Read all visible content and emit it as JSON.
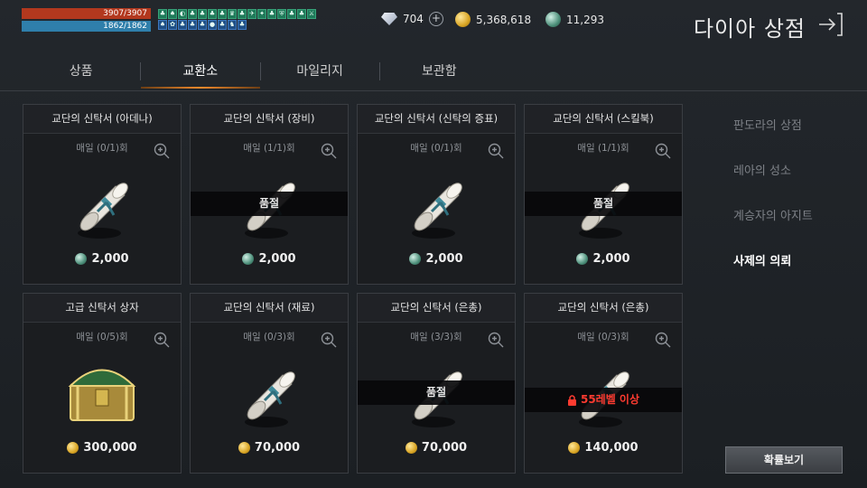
{
  "status": {
    "hp": "3907/3907",
    "mp": "1862/1862",
    "buff_row1": [
      "♣",
      "♠",
      "◐",
      "♣",
      "♣",
      "♣",
      "♣",
      "♛",
      "♣",
      "✈",
      "✦",
      "♣",
      "⛨",
      "♣",
      "♣",
      "⚔"
    ],
    "buff_row2": [
      "♠",
      "✿",
      "♣",
      "♣",
      "♣",
      "●",
      "♣",
      "♞",
      "♣"
    ]
  },
  "currency": {
    "diamond": "704",
    "gold": "5,368,618",
    "silver": "11,293"
  },
  "header": {
    "title": "다이아 상점"
  },
  "tabs": [
    {
      "label": "상품",
      "active": false
    },
    {
      "label": "교환소",
      "active": true
    },
    {
      "label": "마일리지",
      "active": false
    },
    {
      "label": "보관함",
      "active": false
    }
  ],
  "items": [
    {
      "title": "교단의 신탁서 (아데나)",
      "limit": "매일 (0/1)회",
      "price": "2,000",
      "currency": "silver",
      "overlay": "",
      "icon": "scroll-icon"
    },
    {
      "title": "교단의 신탁서 (장비)",
      "limit": "매일 (1/1)회",
      "price": "2,000",
      "currency": "silver",
      "overlay": "품절",
      "icon": "scroll-icon"
    },
    {
      "title": "교단의 신탁서 (신탁의 증표)",
      "limit": "매일 (0/1)회",
      "price": "2,000",
      "currency": "silver",
      "overlay": "",
      "icon": "scroll-icon"
    },
    {
      "title": "교단의 신탁서 (스킬북)",
      "limit": "매일 (1/1)회",
      "price": "2,000",
      "currency": "silver",
      "overlay": "품절",
      "icon": "scroll-icon"
    },
    {
      "title": "고급 신탁서 상자",
      "limit": "매일 (0/5)회",
      "price": "300,000",
      "currency": "gold",
      "overlay": "",
      "icon": "treasure-chest-icon"
    },
    {
      "title": "교단의 신탁서 (재료)",
      "limit": "매일 (0/3)회",
      "price": "70,000",
      "currency": "gold",
      "overlay": "",
      "icon": "scroll-icon"
    },
    {
      "title": "교단의 신탁서 (은총)",
      "limit": "매일 (3/3)회",
      "price": "70,000",
      "currency": "gold",
      "overlay": "품절",
      "icon": "scroll-icon"
    },
    {
      "title": "교단의 신탁서 (은총)",
      "limit": "매일 (0/3)회",
      "price": "140,000",
      "currency": "gold",
      "overlay": "",
      "lock": "55레벨 이상",
      "icon": "scroll-icon"
    }
  ],
  "side_menu": [
    {
      "label": "판도라의 상점",
      "active": false
    },
    {
      "label": "레아의 성소",
      "active": false
    },
    {
      "label": "계승자의 아지트",
      "active": false
    },
    {
      "label": "사제의 의뢰",
      "active": true
    }
  ],
  "buttons": {
    "probability": "확률보기"
  },
  "colors": {
    "accent_tab": "#f08a2c",
    "hp_bar": "#b2381e",
    "mp_bar": "#2f7fab",
    "lock_text": "#ff3b30"
  }
}
